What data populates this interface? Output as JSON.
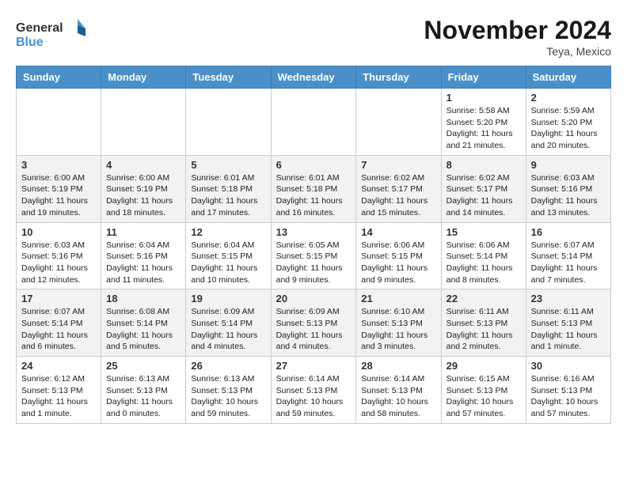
{
  "logo": {
    "line1": "General",
    "line2": "Blue"
  },
  "title": "November 2024",
  "location": "Teya, Mexico",
  "days_header": [
    "Sunday",
    "Monday",
    "Tuesday",
    "Wednesday",
    "Thursday",
    "Friday",
    "Saturday"
  ],
  "weeks": [
    [
      {
        "day": "",
        "info": ""
      },
      {
        "day": "",
        "info": ""
      },
      {
        "day": "",
        "info": ""
      },
      {
        "day": "",
        "info": ""
      },
      {
        "day": "",
        "info": ""
      },
      {
        "day": "1",
        "info": "Sunrise: 5:58 AM\nSunset: 5:20 PM\nDaylight: 11 hours and 21 minutes."
      },
      {
        "day": "2",
        "info": "Sunrise: 5:59 AM\nSunset: 5:20 PM\nDaylight: 11 hours and 20 minutes."
      }
    ],
    [
      {
        "day": "3",
        "info": "Sunrise: 6:00 AM\nSunset: 5:19 PM\nDaylight: 11 hours and 19 minutes."
      },
      {
        "day": "4",
        "info": "Sunrise: 6:00 AM\nSunset: 5:19 PM\nDaylight: 11 hours and 18 minutes."
      },
      {
        "day": "5",
        "info": "Sunrise: 6:01 AM\nSunset: 5:18 PM\nDaylight: 11 hours and 17 minutes."
      },
      {
        "day": "6",
        "info": "Sunrise: 6:01 AM\nSunset: 5:18 PM\nDaylight: 11 hours and 16 minutes."
      },
      {
        "day": "7",
        "info": "Sunrise: 6:02 AM\nSunset: 5:17 PM\nDaylight: 11 hours and 15 minutes."
      },
      {
        "day": "8",
        "info": "Sunrise: 6:02 AM\nSunset: 5:17 PM\nDaylight: 11 hours and 14 minutes."
      },
      {
        "day": "9",
        "info": "Sunrise: 6:03 AM\nSunset: 5:16 PM\nDaylight: 11 hours and 13 minutes."
      }
    ],
    [
      {
        "day": "10",
        "info": "Sunrise: 6:03 AM\nSunset: 5:16 PM\nDaylight: 11 hours and 12 minutes."
      },
      {
        "day": "11",
        "info": "Sunrise: 6:04 AM\nSunset: 5:16 PM\nDaylight: 11 hours and 11 minutes."
      },
      {
        "day": "12",
        "info": "Sunrise: 6:04 AM\nSunset: 5:15 PM\nDaylight: 11 hours and 10 minutes."
      },
      {
        "day": "13",
        "info": "Sunrise: 6:05 AM\nSunset: 5:15 PM\nDaylight: 11 hours and 9 minutes."
      },
      {
        "day": "14",
        "info": "Sunrise: 6:06 AM\nSunset: 5:15 PM\nDaylight: 11 hours and 9 minutes."
      },
      {
        "day": "15",
        "info": "Sunrise: 6:06 AM\nSunset: 5:14 PM\nDaylight: 11 hours and 8 minutes."
      },
      {
        "day": "16",
        "info": "Sunrise: 6:07 AM\nSunset: 5:14 PM\nDaylight: 11 hours and 7 minutes."
      }
    ],
    [
      {
        "day": "17",
        "info": "Sunrise: 6:07 AM\nSunset: 5:14 PM\nDaylight: 11 hours and 6 minutes."
      },
      {
        "day": "18",
        "info": "Sunrise: 6:08 AM\nSunset: 5:14 PM\nDaylight: 11 hours and 5 minutes."
      },
      {
        "day": "19",
        "info": "Sunrise: 6:09 AM\nSunset: 5:14 PM\nDaylight: 11 hours and 4 minutes."
      },
      {
        "day": "20",
        "info": "Sunrise: 6:09 AM\nSunset: 5:13 PM\nDaylight: 11 hours and 4 minutes."
      },
      {
        "day": "21",
        "info": "Sunrise: 6:10 AM\nSunset: 5:13 PM\nDaylight: 11 hours and 3 minutes."
      },
      {
        "day": "22",
        "info": "Sunrise: 6:11 AM\nSunset: 5:13 PM\nDaylight: 11 hours and 2 minutes."
      },
      {
        "day": "23",
        "info": "Sunrise: 6:11 AM\nSunset: 5:13 PM\nDaylight: 11 hours and 1 minute."
      }
    ],
    [
      {
        "day": "24",
        "info": "Sunrise: 6:12 AM\nSunset: 5:13 PM\nDaylight: 11 hours and 1 minute."
      },
      {
        "day": "25",
        "info": "Sunrise: 6:13 AM\nSunset: 5:13 PM\nDaylight: 11 hours and 0 minutes."
      },
      {
        "day": "26",
        "info": "Sunrise: 6:13 AM\nSunset: 5:13 PM\nDaylight: 10 hours and 59 minutes."
      },
      {
        "day": "27",
        "info": "Sunrise: 6:14 AM\nSunset: 5:13 PM\nDaylight: 10 hours and 59 minutes."
      },
      {
        "day": "28",
        "info": "Sunrise: 6:14 AM\nSunset: 5:13 PM\nDaylight: 10 hours and 58 minutes."
      },
      {
        "day": "29",
        "info": "Sunrise: 6:15 AM\nSunset: 5:13 PM\nDaylight: 10 hours and 57 minutes."
      },
      {
        "day": "30",
        "info": "Sunrise: 6:16 AM\nSunset: 5:13 PM\nDaylight: 10 hours and 57 minutes."
      }
    ]
  ]
}
